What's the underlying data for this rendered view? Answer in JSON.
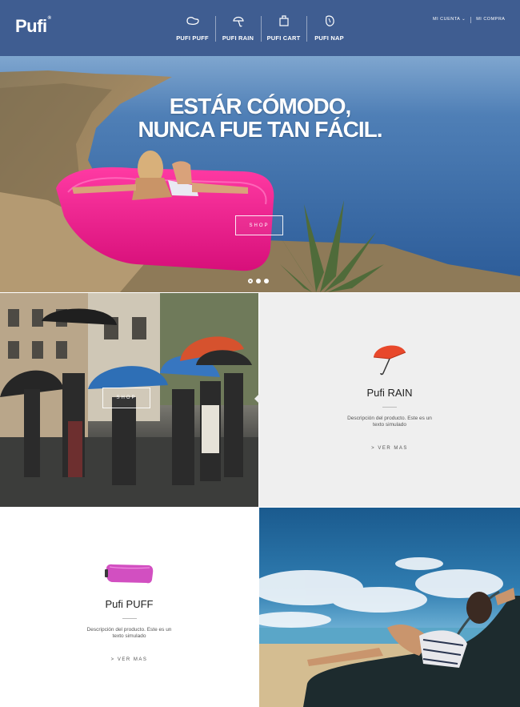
{
  "brand": {
    "logo": "Pufi",
    "trademark": "®"
  },
  "nav": {
    "items": [
      {
        "label": "PUFI PUFF",
        "icon": "puff-icon"
      },
      {
        "label": "PUFI RAIN",
        "icon": "umbrella-icon"
      },
      {
        "label": "PUFI CART",
        "icon": "cart-icon"
      },
      {
        "label": "PUFI NAP",
        "icon": "nap-icon"
      }
    ],
    "account_label": "MI CUENTA ⌄",
    "cart_label": "MI COMPRA"
  },
  "hero": {
    "title_line1": "ESTÁR CÓMODO,",
    "title_line2": "NUNCA FUE TAN FÁCIL.",
    "shop_label": "SHOP",
    "slides": 3,
    "active_slide": 1
  },
  "rain": {
    "shop_label": "SHOP",
    "product_name": "Pufi RAIN",
    "description": "Descripción del producto. Este es un texto simulado",
    "more_label": "> VER MAS",
    "product_color": "#e8482b"
  },
  "puff": {
    "product_name": "Pufi PUFF",
    "description": "Descripción del producto. Este es un texto simulado",
    "more_label": "> VER MAS",
    "product_color": "#d24fc1"
  },
  "colors": {
    "accent_pink": "#ea1b8a",
    "panel_grey": "#efefef"
  }
}
